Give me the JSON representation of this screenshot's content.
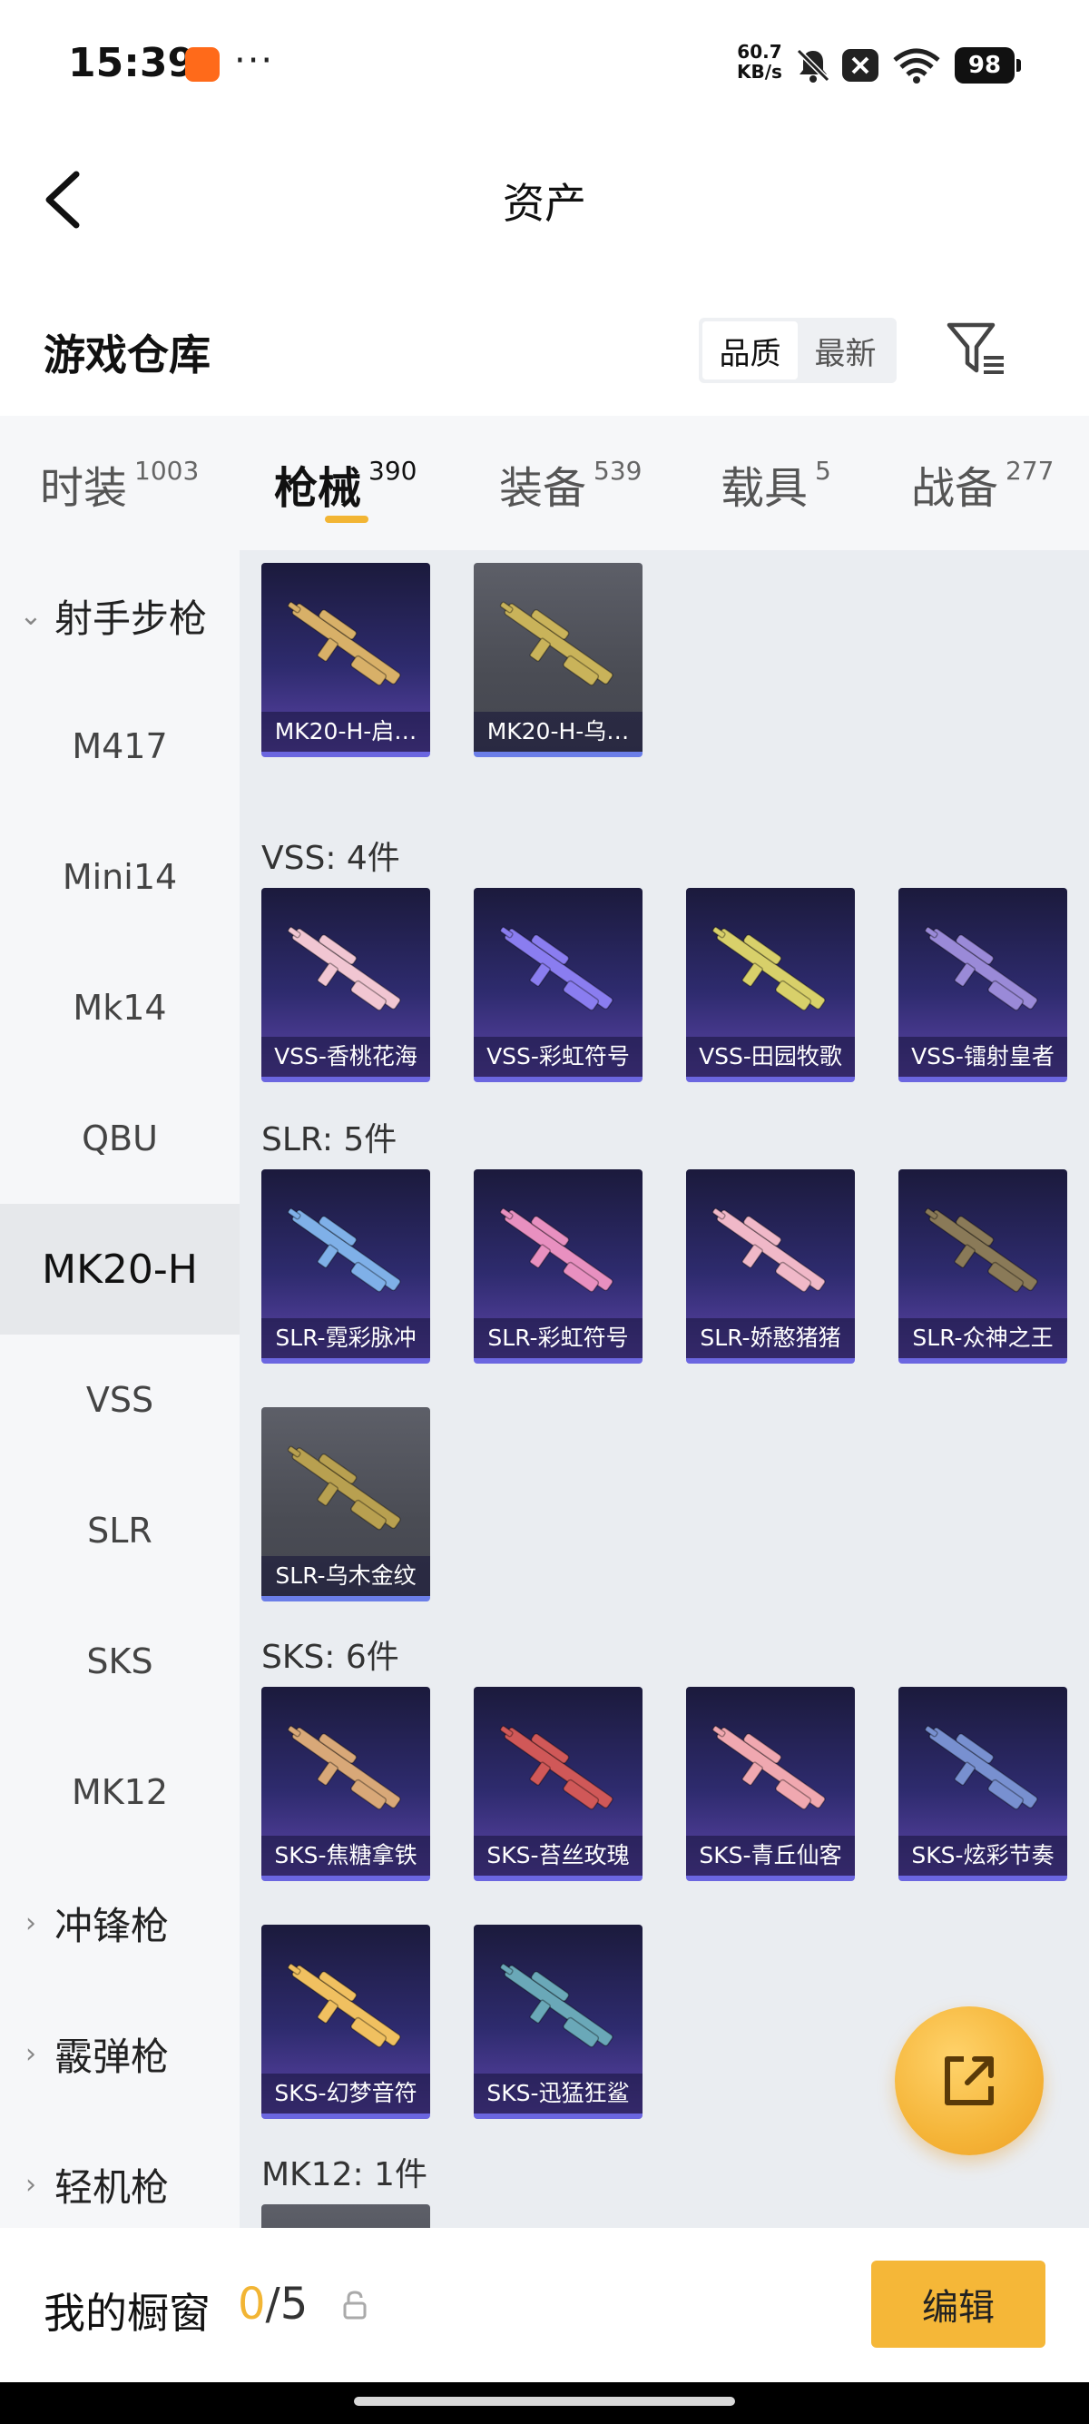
{
  "status_bar": {
    "time": "15:39",
    "dots": "···",
    "net_speed_value": "60.7",
    "net_speed_unit": "KB/s",
    "battery": "98",
    "icons": [
      "app-notification-icon",
      "mute-icon",
      "x-badge-icon",
      "wifi-icon",
      "battery-icon"
    ]
  },
  "header": {
    "back_icon": "chevron-left-icon",
    "title": "资产"
  },
  "warehouse": {
    "title": "游戏仓库",
    "sort_options": [
      "品质",
      "最新"
    ],
    "sort_selected": "品质",
    "filter_icon": "filter-icon"
  },
  "tabs": [
    {
      "label": "时装",
      "count": "1003"
    },
    {
      "label": "枪械",
      "count": "390"
    },
    {
      "label": "装备",
      "count": "539"
    },
    {
      "label": "载具",
      "count": "5"
    },
    {
      "label": "战备",
      "count": "277"
    }
  ],
  "active_tab": "枪械",
  "sidebar": {
    "items": [
      {
        "label": "射手步枪",
        "type": "group",
        "expanded": true
      },
      {
        "label": "M417"
      },
      {
        "label": "Mini14"
      },
      {
        "label": "Mk14"
      },
      {
        "label": "QBU"
      },
      {
        "label": "MK20-H",
        "active": true
      },
      {
        "label": "VSS"
      },
      {
        "label": "SLR"
      },
      {
        "label": "SKS"
      },
      {
        "label": "MK12"
      },
      {
        "label": "冲锋枪",
        "type": "group",
        "expanded": false
      },
      {
        "label": "霰弹枪",
        "type": "group",
        "expanded": false
      },
      {
        "label": "轻机枪",
        "type": "group",
        "expanded": false
      }
    ]
  },
  "content": {
    "sections": [
      {
        "label": "",
        "items": [
          {
            "name": "MK20-H-启…",
            "color": "#d8b068"
          },
          {
            "name": "MK20-H-乌…",
            "color": "#c9b35a",
            "grey": true
          }
        ]
      },
      {
        "label": "VSS: 4件",
        "items": [
          {
            "name": "VSS-香桃花海",
            "color": "#f1c6d2"
          },
          {
            "name": "VSS-彩虹符号",
            "color": "#8a7df0"
          },
          {
            "name": "VSS-田园牧歌",
            "color": "#d8d06a"
          },
          {
            "name": "VSS-镭射皇者",
            "color": "#9a8ad8"
          }
        ]
      },
      {
        "label": "SLR: 5件",
        "items": [
          {
            "name": "SLR-霓彩脉冲",
            "color": "#7fb0e8"
          },
          {
            "name": "SLR-彩虹符号",
            "color": "#e890c0"
          },
          {
            "name": "SLR-娇憨猪猪",
            "color": "#f0b8c8"
          },
          {
            "name": "SLR-众神之王",
            "color": "#8a7a58"
          },
          {
            "name": "SLR-乌木金纹",
            "color": "#b8a050",
            "grey": true
          }
        ]
      },
      {
        "label": "SKS: 6件",
        "items": [
          {
            "name": "SKS-焦糖拿铁",
            "color": "#d8a878"
          },
          {
            "name": "SKS-苔丝玫瑰",
            "color": "#d05858"
          },
          {
            "name": "SKS-青丘仙客",
            "color": "#f0a8b0"
          },
          {
            "name": "SKS-炫彩节奏",
            "color": "#7890d0"
          },
          {
            "name": "SKS-幻梦音符",
            "color": "#f0c060"
          },
          {
            "name": "SKS-迅猛狂鲨",
            "color": "#6aa8b8"
          }
        ]
      },
      {
        "label": "MK12: 1件",
        "items": [
          {
            "name": "",
            "color": "#7a7a7a",
            "grey": true
          }
        ]
      }
    ]
  },
  "fab": {
    "icon": "external-share-icon"
  },
  "bottom_bar": {
    "label": "我的橱窗",
    "current": "0",
    "separator": "/",
    "max": "5",
    "lock_icon": "lock-icon",
    "edit_label": "编辑"
  }
}
